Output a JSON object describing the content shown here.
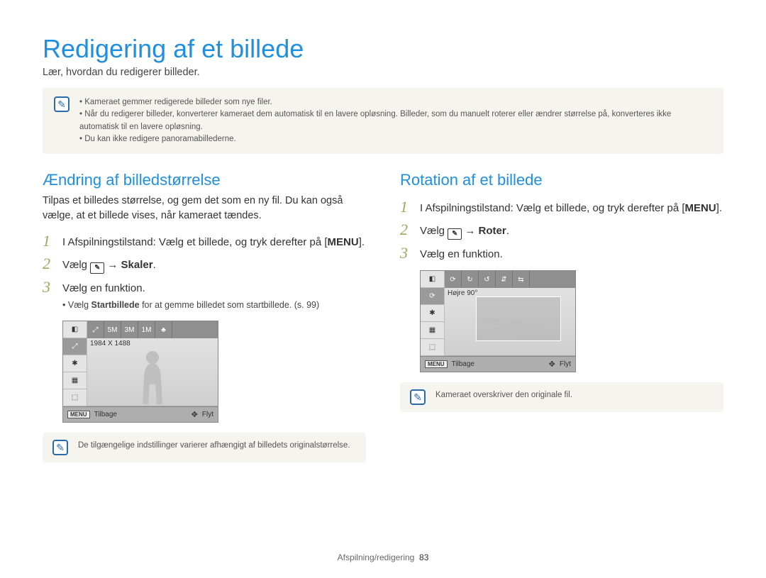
{
  "page": {
    "title": "Redigering af et billede",
    "subtitle": "Lær, hvordan du redigerer billeder."
  },
  "top_note": {
    "items": [
      "Kameraet gemmer redigerede billeder som nye filer.",
      "Når du redigerer billeder, konverterer kameraet dem automatisk til en lavere opløsning. Billeder, som du manuelt roterer eller ændrer størrelse på, konverteres ikke automatisk til en lavere opløsning.",
      "Du kan ikke redigere panoramabillederne."
    ]
  },
  "left": {
    "heading": "Ændring af billedstørrelse",
    "intro": "Tilpas et billedes størrelse, og gem det som en ny fil. Du kan også vælge, at et billede vises, når kameraet tændes.",
    "step1_pre": "I Afspilningstilstand: Vælg et billede, og tryk derefter på [",
    "step1_menu": "MENU",
    "step1_post": "].",
    "step2_pre": "Vælg ",
    "step2_icon": "✎",
    "step2_arrow": " → ",
    "step2_target": "Skaler",
    "step2_post": ".",
    "step3": "Vælg en funktion.",
    "sub_bullet_pre": "Vælg ",
    "sub_bullet_bold": "Startbillede",
    "sub_bullet_post": " for at gemme billedet som startbillede. (s. 99)",
    "cam_status": "1984 X 1488",
    "cam_back": "Tilbage",
    "cam_move": "Flyt",
    "cam_menu": "MENU",
    "bottom_note": "De tilgængelige indstillinger varierer afhængigt af billedets originalstørrelse."
  },
  "right": {
    "heading": "Rotation af et billede",
    "step1_pre": "I Afspilningstilstand: Vælg et billede, og tryk derefter på [",
    "step1_menu": "MENU",
    "step1_post": "].",
    "step2_pre": "Vælg ",
    "step2_icon": "✎",
    "step2_arrow": " → ",
    "step2_target": "Roter",
    "step2_post": ".",
    "step3": "Vælg en funktion.",
    "cam_status": "Højre 90°",
    "cam_back": "Tilbage",
    "cam_move": "Flyt",
    "cam_menu": "MENU",
    "bottom_note": "Kameraet overskriver den originale fil."
  },
  "footer": {
    "section": "Afspilning/redigering",
    "page_number": "83"
  }
}
